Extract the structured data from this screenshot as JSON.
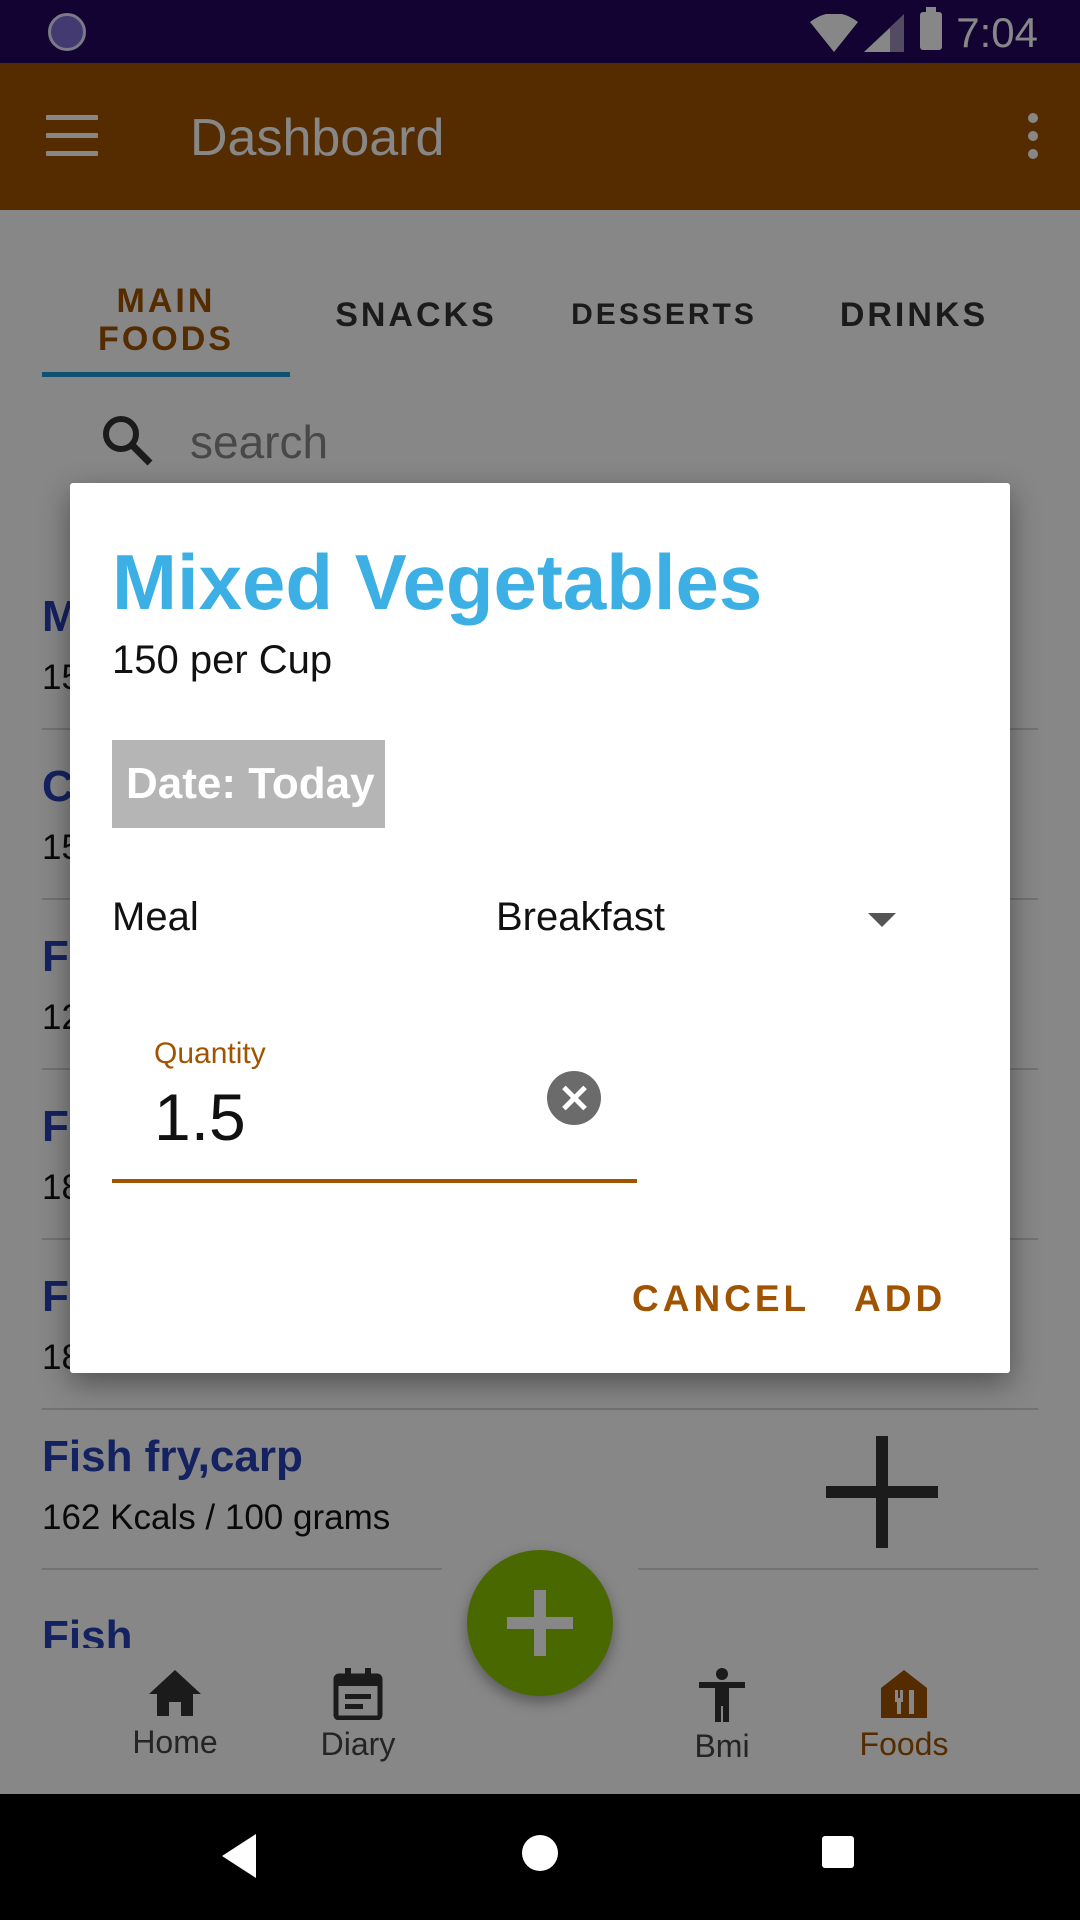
{
  "status_bar": {
    "time": "7:04"
  },
  "app_bar": {
    "title": "Dashboard"
  },
  "tabs": [
    {
      "label": "MAIN\nFOODS"
    },
    {
      "label": "SNACKS"
    },
    {
      "label": "DESSERTS"
    },
    {
      "label": "DRINKS"
    }
  ],
  "search": {
    "placeholder": "search"
  },
  "food_list": [
    {
      "name": "M",
      "kcal": "15"
    },
    {
      "name": "C",
      "kcal": "15"
    },
    {
      "name": "F",
      "kcal": "12"
    },
    {
      "name": "F",
      "kcal": "18"
    },
    {
      "name": "F",
      "kcal": "18"
    },
    {
      "name": "Fish fry,carp",
      "kcal": "162 Kcals / 100 grams"
    },
    {
      "name": "Fish",
      "kcal": ""
    }
  ],
  "bottom_nav": [
    {
      "label": "Home"
    },
    {
      "label": "Diary"
    },
    {
      "label": "Bmi"
    },
    {
      "label": "Foods"
    }
  ],
  "dialog": {
    "title": "Mixed Vegetables",
    "subtitle": "150 per Cup",
    "date_label": "Date: Today",
    "meal_label": "Meal",
    "meal_value": "Breakfast",
    "quantity_label": "Quantity",
    "quantity_value": "1.5",
    "cancel_label": "CANCEL",
    "add_label": "ADD"
  },
  "colors": {
    "app_bar": "#a15400",
    "status_bar": "#22065f",
    "dialog_title": "#3cb0e4",
    "food_name": "#2841b8",
    "fab": "#8bc400"
  }
}
